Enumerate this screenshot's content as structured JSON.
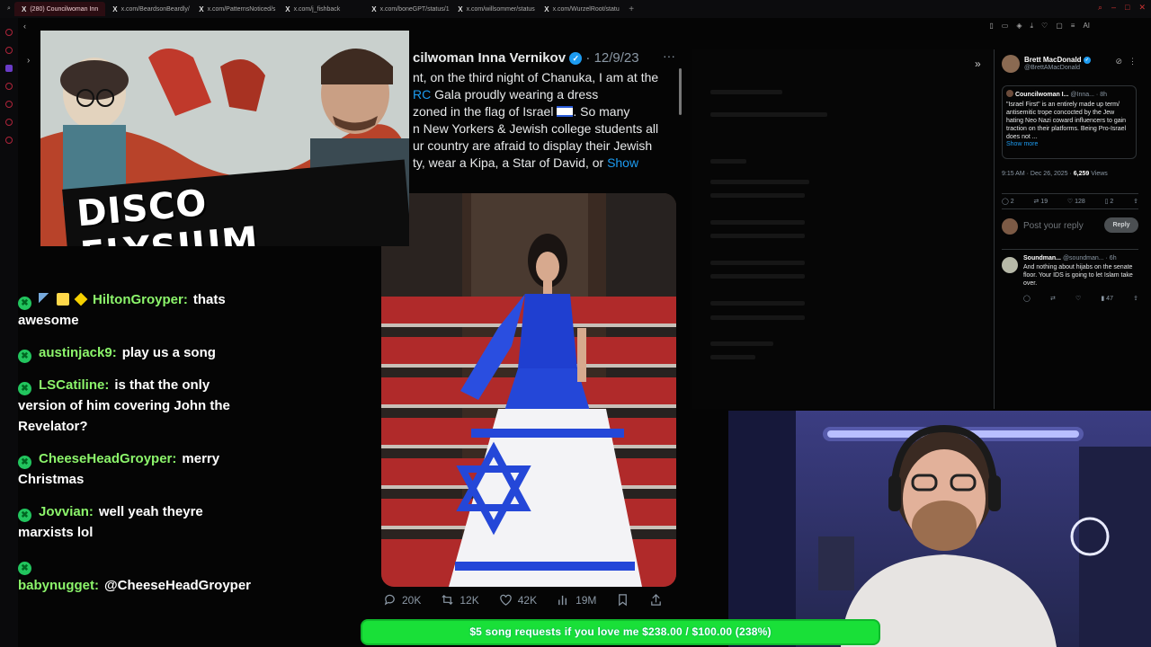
{
  "browser": {
    "tabs": [
      {
        "label": "(280) Councilwoman Inn",
        "active": true
      },
      {
        "label": "x.com/BeardsonBeardly/",
        "active": false
      },
      {
        "label": "x.com/PatternsNoticed/s",
        "active": false
      },
      {
        "label": "x.com/j_fishback",
        "active": false
      },
      {
        "label": "x.com/boneGPT/status/1",
        "active": false
      },
      {
        "label": "x.com/willsommer/status",
        "active": false
      },
      {
        "label": "x.com/WurzelRoot/statu",
        "active": false
      }
    ],
    "new_tab": "+",
    "extension_label": "AI"
  },
  "banner": {
    "title": "DISCO ELYSIUM"
  },
  "tweet": {
    "author": "cilwoman Inna Vernikov",
    "verified_mark": "✓",
    "date": "· 12/9/23",
    "more": "···",
    "body": {
      "line1": "nt, on the third night of Chanuka, I am at the",
      "line2a": "RC",
      "line2b": " Gala proudly wearing a dress",
      "line3": "zoned in the flag of Israel ",
      "line3b": ". So many",
      "line4": "n New Yorkers & Jewish college students all",
      "line5": "ur country are afraid to display their Jewish",
      "line6": "ty, wear a Kipa, a Star of David, or ",
      "show": "Show"
    },
    "actions": {
      "replies": "20K",
      "reposts": "12K",
      "likes": "42K",
      "views": "19M"
    }
  },
  "chat": {
    "messages": [
      {
        "user": "HiltonGroyper:",
        "text": "thats awesome"
      },
      {
        "user": "austinjack9:",
        "text": "play us a song"
      },
      {
        "user": "LSCatiline:",
        "text": "is that the only version of him covering John the Revelator?"
      },
      {
        "user": "CheeseHeadGroyper:",
        "text": "merry Christmas"
      },
      {
        "user": "Jovvian:",
        "text": "well yeah theyre marxists lol"
      },
      {
        "user": "babynugget:",
        "text": "@CheeseHeadGroyper merry"
      }
    ]
  },
  "right_panel": {
    "author_name": "Brett MacDonald",
    "author_handle": "@BrettAMacDonald",
    "quote": {
      "name": "Councilwoman I...",
      "handle": "@Inna... · 8h",
      "text": "\"Israel First\" is an entirely made up term/ antisemitic trope concocted by the Jew hating Neo Nazi coward influencers to gain traction on their platforms. Being Pro-Israel does not ...",
      "more": "Show more"
    },
    "meta_time": "9:15 AM · Dec 26, 2025 · ",
    "meta_views": "6,259",
    "meta_views_label": " Views",
    "stats": {
      "replies": "2",
      "reposts": "19",
      "likes": "128",
      "bookmarks": "2"
    },
    "reply_placeholder": "Post your reply",
    "reply_button": "Reply",
    "comment": {
      "name": "Soundman...",
      "handle": "@soundman... · 6h",
      "text": "And nothing about hijabs on the senate floor. Your IDS is going to let Islam take over.",
      "views": "47"
    }
  },
  "goal_bar": {
    "text": "$5 song requests if you love me $238.00 / $100.00 (238%)",
    "progress": 2.38
  },
  "colors": {
    "goal_green": "#19e038",
    "x_blue": "#1d9bf0",
    "chat_username": "#8cf56b",
    "sub_badge": "#22c55e"
  }
}
